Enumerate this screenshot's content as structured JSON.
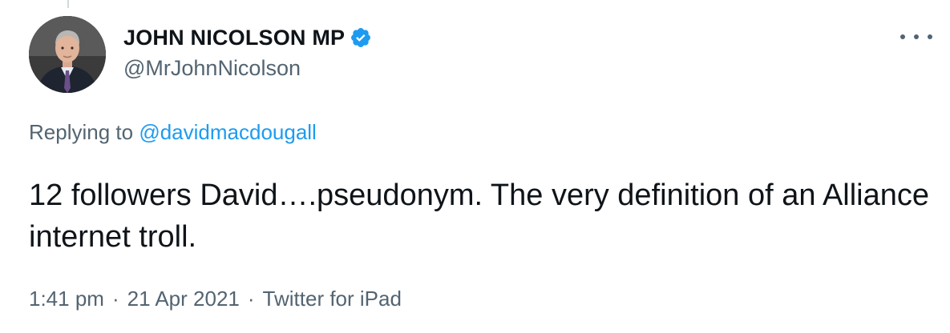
{
  "author": {
    "display_name": "JOHN NICOLSON MP",
    "handle": "@MrJohnNicolson",
    "verified_icon": "verified-badge-icon",
    "avatar_icon": "profile-photo"
  },
  "menu": {
    "more_icon": "more-options-icon"
  },
  "reply": {
    "prefix": "Replying to",
    "target": "@davidmacdougall"
  },
  "tweet": {
    "text": "12 followers David….pseudonym. The very definition of an Alliance internet troll."
  },
  "meta": {
    "time": "1:41 pm",
    "date": "21 Apr 2021",
    "source": "Twitter for iPad",
    "separator": "·"
  },
  "colors": {
    "text_primary": "#0f1419",
    "text_secondary": "#536471",
    "link": "#1d9bf0",
    "verified": "#1d9bf0"
  }
}
